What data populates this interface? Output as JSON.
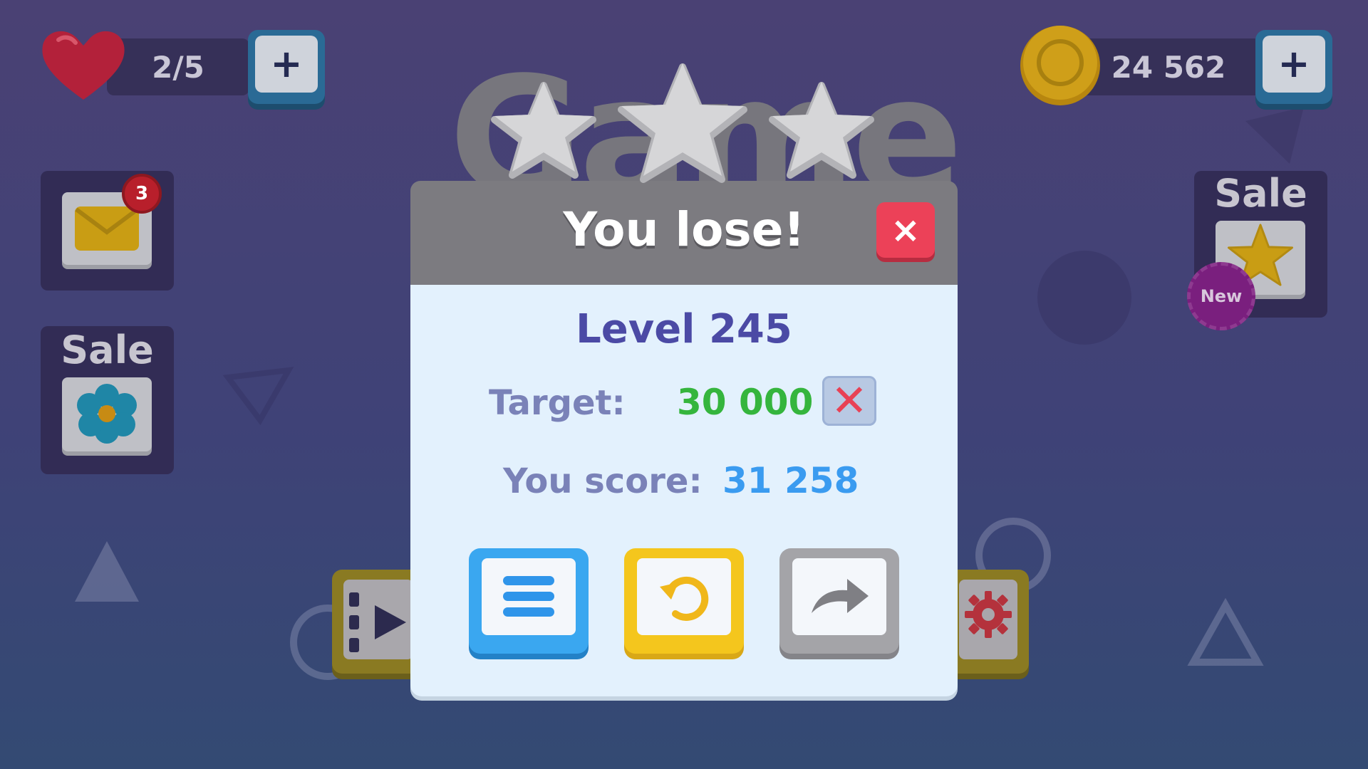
{
  "hud": {
    "lives": {
      "value": "2/5",
      "icon": "heart-icon",
      "color": "#c0243a"
    },
    "coins": {
      "value": "24 562",
      "icon": "coin-icon",
      "color": "#d4a51a"
    },
    "add_label": "+"
  },
  "background_title": "Game",
  "left_panel": {
    "mail": {
      "icon": "envelope-icon",
      "badge": "3"
    },
    "sale": {
      "label": "Sale",
      "icon": "flower-icon"
    }
  },
  "right_panel": {
    "sale": {
      "label": "Sale",
      "icon": "star-icon",
      "badge": "New"
    }
  },
  "dialog": {
    "title": "You lose!",
    "close_label": "×",
    "stars": {
      "earned": 0,
      "total": 3
    },
    "level": "Level 245",
    "target_label": "Target:",
    "target_value": "30 000",
    "target_status": "✕",
    "score_label": "You score:",
    "score_value": "31 258",
    "buttons": [
      {
        "name": "menu",
        "icon": "menu-icon"
      },
      {
        "name": "retry",
        "icon": "retry-icon"
      },
      {
        "name": "next",
        "icon": "arrow-right-icon"
      }
    ]
  },
  "colors": {
    "level_text": "#4b4aa5",
    "target_value": "#35b53d",
    "score_value": "#3a9bf0",
    "close_button": "#ec4158"
  }
}
